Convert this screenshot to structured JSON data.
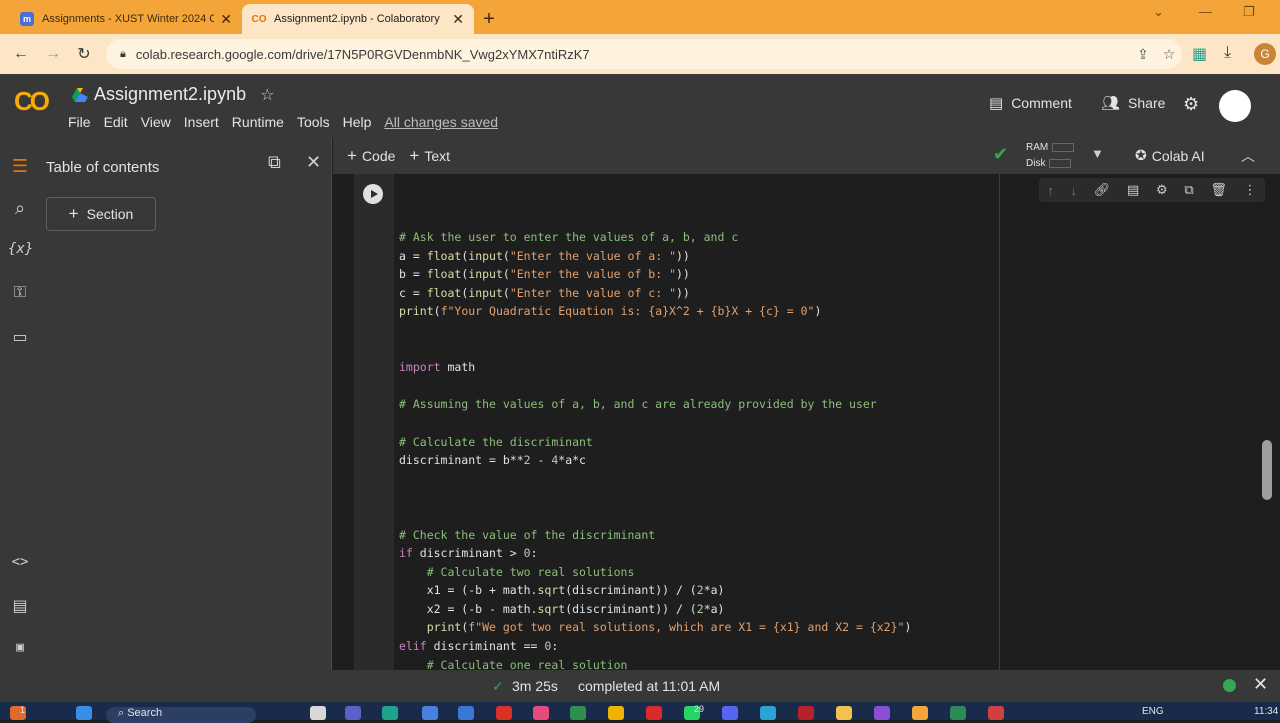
{
  "browser": {
    "tabs": [
      {
        "title": "Assignments - XUST Winter 2024 C",
        "favicon": "moodle-icon",
        "active": false
      },
      {
        "title": "Assignment2.ipynb - Colaboratory",
        "favicon": "colab-icon",
        "active": true
      }
    ],
    "url": "colab.research.google.com/drive/17N5P0RGVDenmbNK_Vwg2xYMX7ntiRzK7",
    "profile_initial": "G"
  },
  "colab": {
    "logo_text": "CO",
    "notebook_title": "Assignment2.ipynb",
    "menu": [
      "File",
      "Edit",
      "View",
      "Insert",
      "Runtime",
      "Tools",
      "Help"
    ],
    "save_status": "All changes saved",
    "comment_label": "Comment",
    "share_label": "Share"
  },
  "sidebar": {
    "title": "Table of contents",
    "section_button": "Section"
  },
  "toolbar": {
    "code_label": "Code",
    "text_label": "Text",
    "ram_label": "RAM",
    "disk_label": "Disk",
    "colab_ai_label": "Colab AI"
  },
  "code_lines": [
    "# Ask the user to enter the values of a, b, and c",
    "a = float(input(\"Enter the value of a: \"))",
    "b = float(input(\"Enter the value of b: \"))",
    "c = float(input(\"Enter the value of c: \"))",
    "print(f\"Your Quadratic Equation is: {a}X^2 + {b}X + {c} = 0\")",
    "",
    "",
    "import math",
    "",
    "# Assuming the values of a, b, and c are already provided by the user",
    "",
    "# Calculate the discriminant",
    "discriminant = b**2 - 4*a*c",
    "",
    "",
    "",
    "# Check the value of the discriminant",
    "if discriminant > 0:",
    "    # Calculate two real solutions",
    "    x1 = (-b + math.sqrt(discriminant)) / (2*a)",
    "    x2 = (-b - math.sqrt(discriminant)) / (2*a)",
    "    print(f\"We got two real solutions, which are X1 = {x1} and X2 = {x2}\")",
    "elif discriminant == 0:",
    "    # Calculate one real solution"
  ],
  "status": {
    "duration": "3m 25s",
    "completed": "completed at 11:01 AM"
  },
  "taskbar": {
    "search_placeholder": "Search",
    "lang": "ENG",
    "time": "11:34",
    "badge_count": "1",
    "whatsapp_badge": "29"
  },
  "colors": {
    "tabstrip": "#f3a53a",
    "colab_bg": "#383838",
    "editor_bg": "#1e1e1e",
    "accent_green": "#34a853"
  }
}
